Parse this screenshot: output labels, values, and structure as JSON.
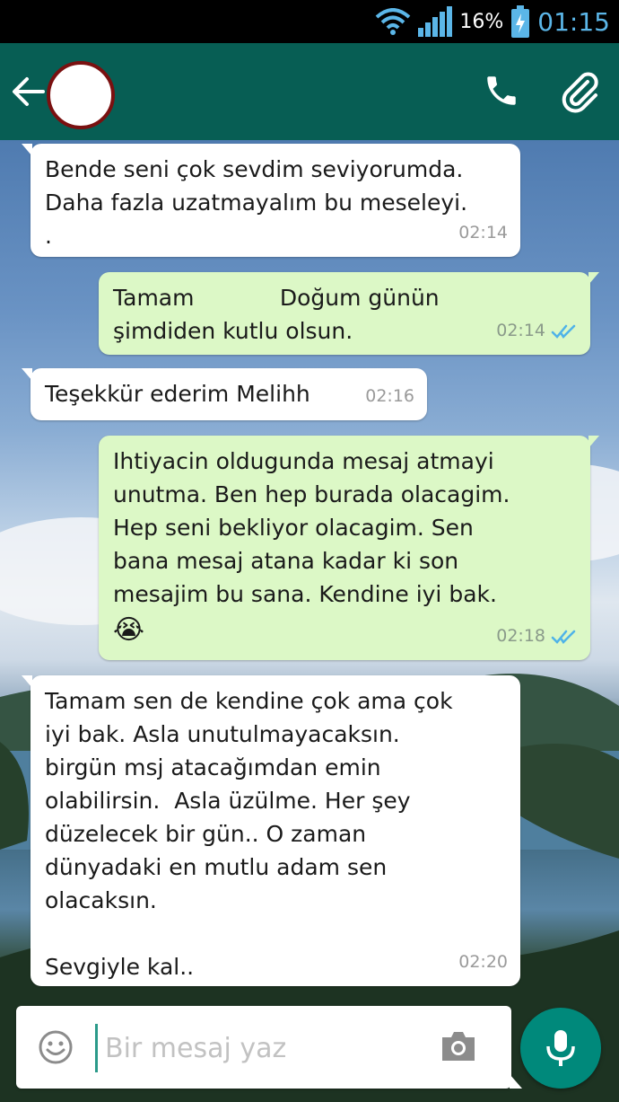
{
  "status_bar": {
    "battery_percent": "16%",
    "time": "01:15",
    "clock_color": "#5bb6e8"
  },
  "header": {
    "background": "#075e54",
    "icons": [
      "arrow-left-icon",
      "phone-icon",
      "paperclip-icon"
    ]
  },
  "messages": [
    {
      "direction": "incoming",
      "text": "Bende seni çok sevdim seviyorumda.\nDaha fazla uzatmayalım bu meseleyi.\n.",
      "time": "02:14"
    },
    {
      "direction": "outgoing",
      "text": "Tamam            Doğum günün\nşimdiden kutlu olsun.",
      "time": "02:14",
      "status": "read"
    },
    {
      "direction": "incoming",
      "text": "Teşekkür ederim Melihh",
      "time": "02:16"
    },
    {
      "direction": "outgoing",
      "text": "Ihtiyacin oldugunda mesaj atmayi\nunutma. Ben hep burada olacagim.\nHep seni bekliyor olacagim. Sen\nbana mesaj atana kadar ki son\nmesajim bu sana. Kendine iyi bak.",
      "emoji": "😭",
      "time": "02:18",
      "status": "read"
    },
    {
      "direction": "incoming",
      "text": "Tamam sen de kendine çok ama çok\niyi bak. Asla unutulmayacaksın.\nbirgün msj atacağımdan emin\nolabilirsin.  Asla üzülme. Her şey\ndüzelecek bir gün.. O zaman\ndünyadaki en mutlu adam sen\nolacaksın.\n\nSevgiyle kal..",
      "time": "02:20"
    }
  ],
  "composer": {
    "placeholder": "Bir mesaj yaz",
    "icons": [
      "emoji-icon",
      "camera-icon",
      "microphone-icon"
    ],
    "mic_color": "#00897b"
  },
  "colors": {
    "outgoing_bubble": "#dcf8c6",
    "incoming_bubble": "#ffffff",
    "read_ticks": "#4fb3e8"
  }
}
